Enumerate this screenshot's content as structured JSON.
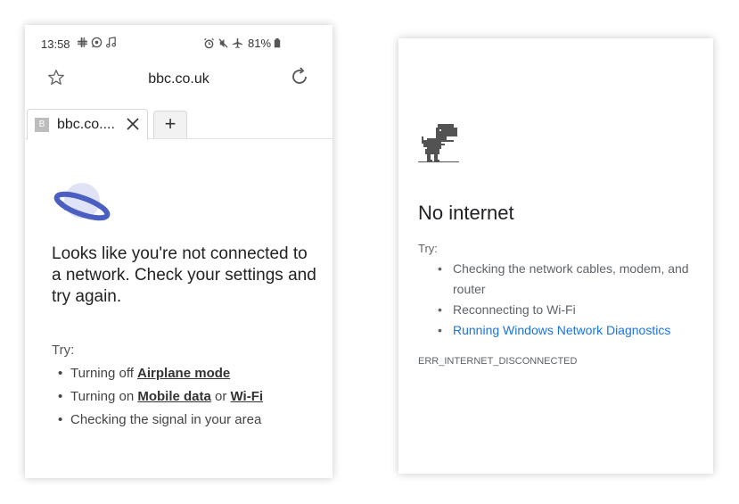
{
  "phone": {
    "status": {
      "time": "13:58",
      "battery": "81%"
    },
    "address_bar": {
      "url": "bbc.co.uk"
    },
    "tabs": [
      {
        "favicon_letter": "B",
        "title": "bbc.co...."
      }
    ],
    "new_tab_label": "+",
    "offline_message": "Looks like you're not connected to a network. Check your settings and try again.",
    "try_label": "Try:",
    "suggestions": {
      "airplane_prefix": "Turning off ",
      "airplane_link": "Airplane mode",
      "data_prefix": "Turning on ",
      "data_link": "Mobile data",
      "data_or": " or ",
      "wifi_link": "Wi-Fi",
      "signal": "Checking the signal in your area"
    }
  },
  "chrome": {
    "heading": "No internet",
    "try_label": "Try:",
    "suggestions": {
      "cables": "Checking the network cables, modem, and router",
      "wifi": "Reconnecting to Wi-Fi",
      "diagnostics": "Running Windows Network Diagnostics"
    },
    "error_code": "ERR_INTERNET_DISCONNECTED"
  },
  "colors": {
    "chrome_link": "#1a73e8",
    "planet_blue": "#4a5fc1",
    "planet_light": "#dfe3f5"
  },
  "icons": [
    "slack-icon",
    "whatsapp-icon",
    "music-icon",
    "alarm-icon",
    "mute-icon",
    "airplane-icon",
    "battery-icon",
    "star-icon",
    "reload-icon",
    "close-icon",
    "planet-icon",
    "dino-icon"
  ]
}
